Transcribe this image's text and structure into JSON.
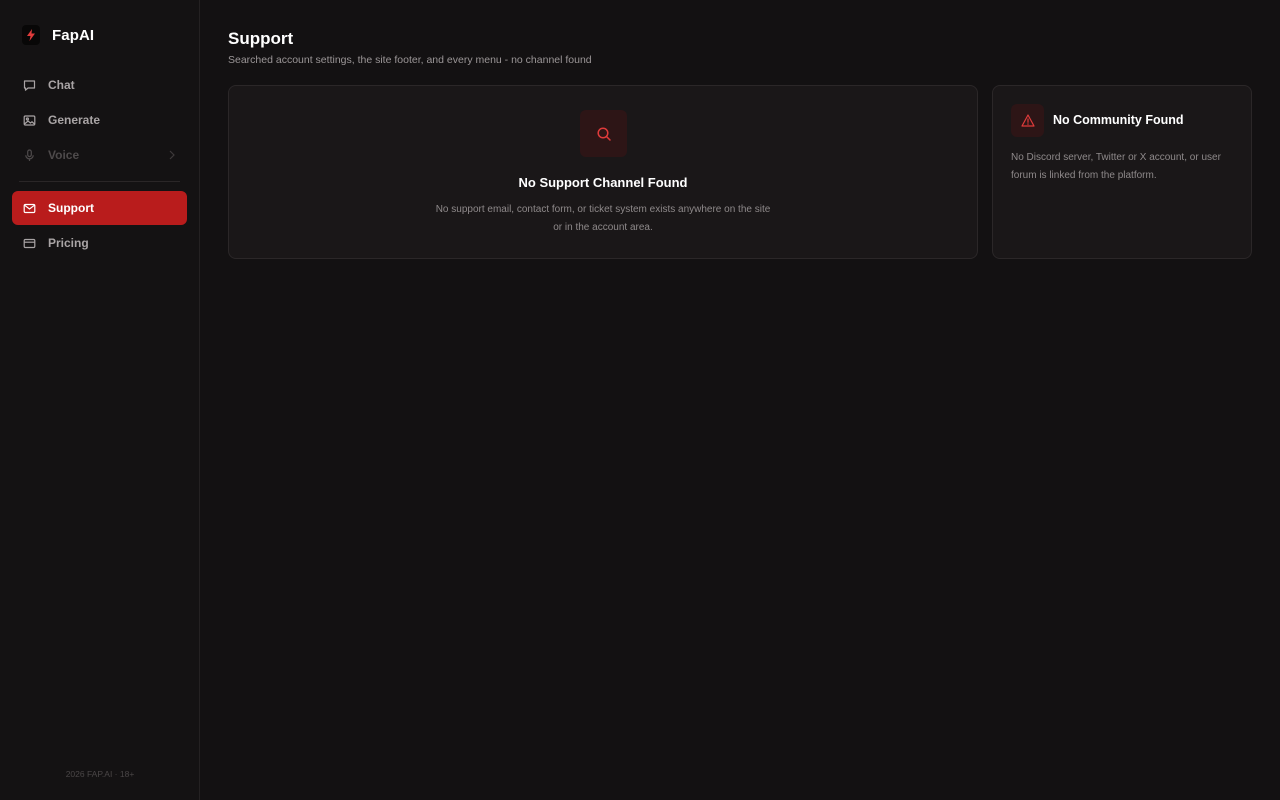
{
  "brand": {
    "name": "FapAI",
    "logo_icon": "bolt-icon",
    "accent": "#e03b3b"
  },
  "sidebar": {
    "items": [
      {
        "label": "Chat",
        "icon": "chat-bubble-icon",
        "state": "normal"
      },
      {
        "label": "Generate",
        "icon": "image-icon",
        "state": "normal"
      },
      {
        "label": "Voice",
        "icon": "microphone-icon",
        "state": "disabled"
      },
      {
        "label": "Support",
        "icon": "mail-icon",
        "state": "active"
      },
      {
        "label": "Pricing",
        "icon": "credit-card-icon",
        "state": "normal"
      }
    ],
    "footer": "2026 FAP.AI · 18+"
  },
  "page": {
    "title": "Support",
    "subtitle": "Searched account settings, the site footer, and every menu - no channel found"
  },
  "cards": {
    "support": {
      "icon": "search-icon",
      "heading": "No Support Channel Found",
      "text": "No support email, contact form, or ticket system exists anywhere on the site or in the account area."
    },
    "community": {
      "icon": "warning-triangle-icon",
      "heading": "No Community Found",
      "text": "No Discord server, Twitter or X account, or user forum is linked from the platform."
    }
  },
  "colors": {
    "background": "#131112",
    "sidebar": "#141213",
    "card": "#1a1718",
    "active_nav": "#b91c1c",
    "icon_accent": "#e03b3b"
  }
}
